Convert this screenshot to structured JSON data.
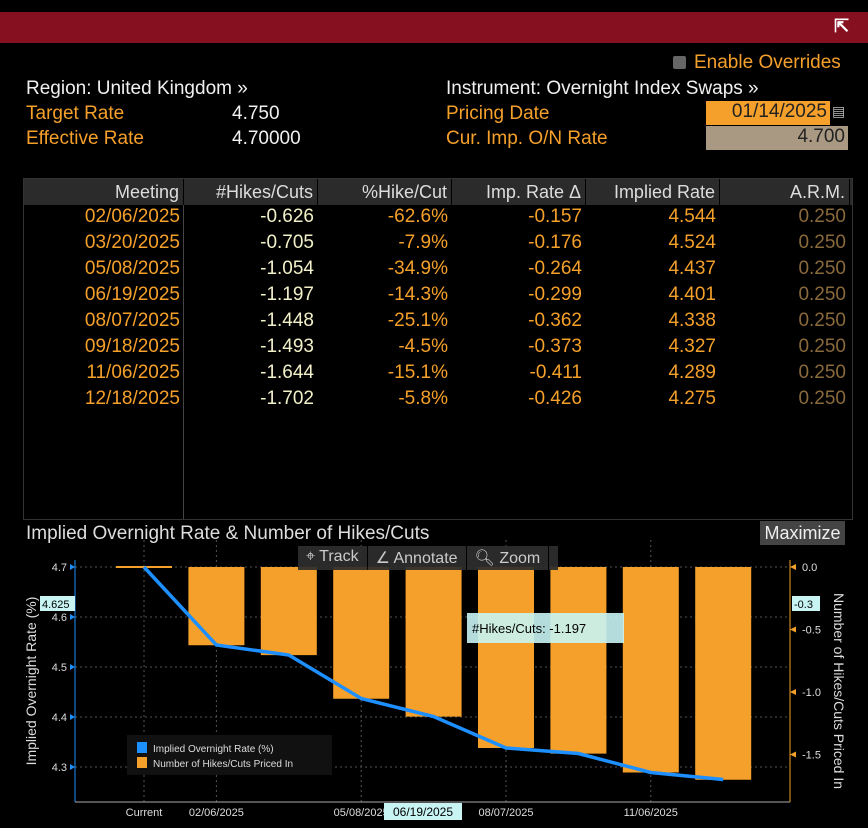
{
  "header": {
    "popout_icon": "external-link-icon"
  },
  "overrides": {
    "label": "Enable Overrides",
    "checked": false
  },
  "region": {
    "label": "Region: United Kingdom »"
  },
  "instrument": {
    "label": "Instrument: Overnight Index Swaps »"
  },
  "target_rate": {
    "label": "Target Rate",
    "value": "4.750"
  },
  "effective_rate": {
    "label": "Effective Rate",
    "value": "4.70000"
  },
  "pricing_date": {
    "label": "Pricing Date",
    "value": "01/14/2025"
  },
  "cur_rate": {
    "label": "Cur. Imp. O/N Rate",
    "value": "4.700"
  },
  "table": {
    "headers": [
      "Meeting",
      "#Hikes/Cuts",
      "%Hike/Cut",
      "Imp. Rate Δ",
      "Implied Rate",
      "A.R.M."
    ],
    "rows": [
      [
        "02/06/2025",
        "-0.626",
        "-62.6%",
        "-0.157",
        "4.544",
        "0.250"
      ],
      [
        "03/20/2025",
        "-0.705",
        "-7.9%",
        "-0.176",
        "4.524",
        "0.250"
      ],
      [
        "05/08/2025",
        "-1.054",
        "-34.9%",
        "-0.264",
        "4.437",
        "0.250"
      ],
      [
        "06/19/2025",
        "-1.197",
        "-14.3%",
        "-0.299",
        "4.401",
        "0.250"
      ],
      [
        "08/07/2025",
        "-1.448",
        "-25.1%",
        "-0.362",
        "4.338",
        "0.250"
      ],
      [
        "09/18/2025",
        "-1.493",
        "-4.5%",
        "-0.373",
        "4.327",
        "0.250"
      ],
      [
        "11/06/2025",
        "-1.644",
        "-15.1%",
        "-0.411",
        "4.289",
        "0.250"
      ],
      [
        "12/18/2025",
        "-1.702",
        "-5.8%",
        "-0.426",
        "4.275",
        "0.250"
      ]
    ]
  },
  "chart": {
    "maximize": "Maximize",
    "tools": [
      "Track",
      "Annotate",
      "Zoom"
    ]
  },
  "chart_data": {
    "type": "bar+line",
    "title": "Implied Overnight Rate & Number of Hikes/Cuts",
    "ylabel": "Implied Overnight Rate (%)",
    "y2label": "Number of Hikes/Cuts Priced In",
    "categories": [
      "Current",
      "02/06/2025",
      "03/20/2025",
      "05/08/2025",
      "06/19/2025",
      "08/07/2025",
      "09/18/2025",
      "11/06/2025",
      "12/18/2025"
    ],
    "x_tick_labels": [
      "Current",
      "02/06/2025",
      "05/08/2025",
      "08/07/2025",
      "11/06/2025"
    ],
    "series": [
      {
        "name": "Implied Overnight Rate (%)",
        "axis": "left",
        "type": "line",
        "color": "#1e8fff",
        "values": [
          4.7,
          4.544,
          4.524,
          4.437,
          4.401,
          4.338,
          4.327,
          4.289,
          4.275
        ]
      },
      {
        "name": "Number of Hikes/Cuts Priced In",
        "axis": "right",
        "type": "bar",
        "color": "#f5a02a",
        "values": [
          0,
          -0.626,
          -0.705,
          -1.054,
          -1.197,
          -1.448,
          -1.493,
          -1.644,
          -1.702
        ]
      }
    ],
    "yticks": [
      "4.7",
      "4.6",
      "4.5",
      "4.4",
      "4.3"
    ],
    "y2ticks": [
      "0.0",
      "-0.5",
      "-1.0",
      "-1.5"
    ],
    "ylim": [
      4.23,
      4.72
    ],
    "y2lim": [
      -1.88,
      0.05
    ],
    "crosshair": {
      "left_value": "4.625",
      "right_value": "-0.3",
      "x_label": "06/19/2025",
      "tooltip": "#Hikes/Cuts: -1.197"
    },
    "legend": "bottom-left",
    "grid": true
  }
}
